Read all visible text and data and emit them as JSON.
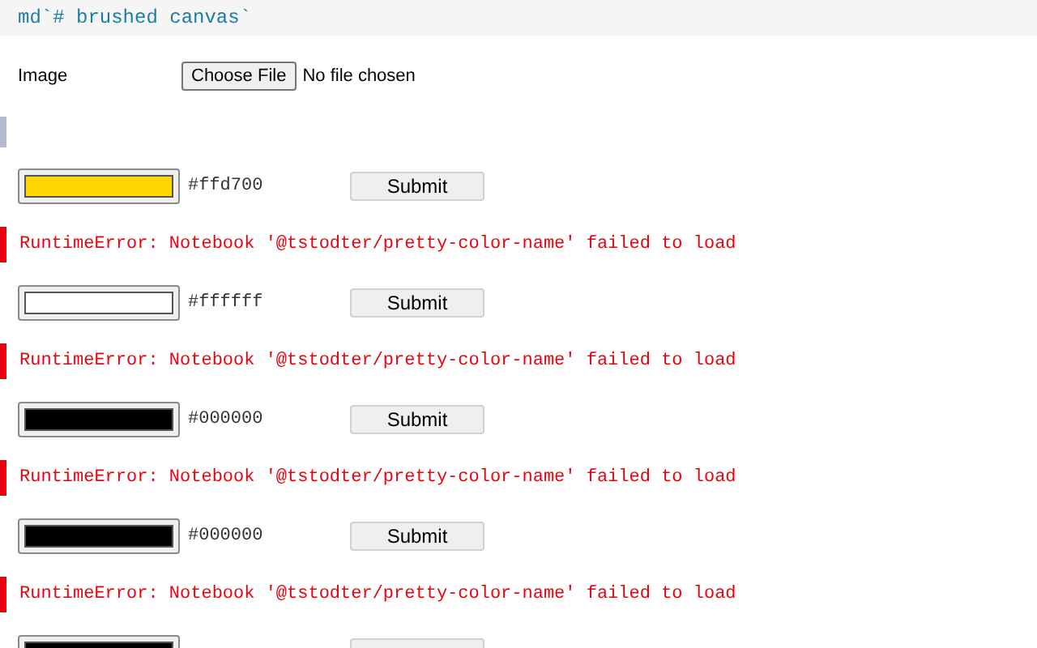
{
  "header": {
    "code": "md`# brushed canvas`"
  },
  "image_field": {
    "label": "Image",
    "button": "Choose File",
    "status": "No file chosen"
  },
  "cells": [
    {
      "kind": "color",
      "color": "#ffd700",
      "hex": "#ffd700",
      "button": "Submit"
    },
    {
      "kind": "error",
      "message": "RuntimeError: Notebook '@tstodter/pretty-color-name' failed to load"
    },
    {
      "kind": "color",
      "color": "#ffffff",
      "hex": "#ffffff",
      "button": "Submit"
    },
    {
      "kind": "error",
      "message": "RuntimeError: Notebook '@tstodter/pretty-color-name' failed to load"
    },
    {
      "kind": "color",
      "color": "#000000",
      "hex": "#000000",
      "button": "Submit"
    },
    {
      "kind": "error",
      "message": "RuntimeError: Notebook '@tstodter/pretty-color-name' failed to load"
    },
    {
      "kind": "color",
      "color": "#000000",
      "hex": "#000000",
      "button": "Submit"
    },
    {
      "kind": "error",
      "message": "RuntimeError: Notebook '@tstodter/pretty-color-name' failed to load"
    },
    {
      "kind": "color",
      "color": "#000000"
    }
  ]
}
